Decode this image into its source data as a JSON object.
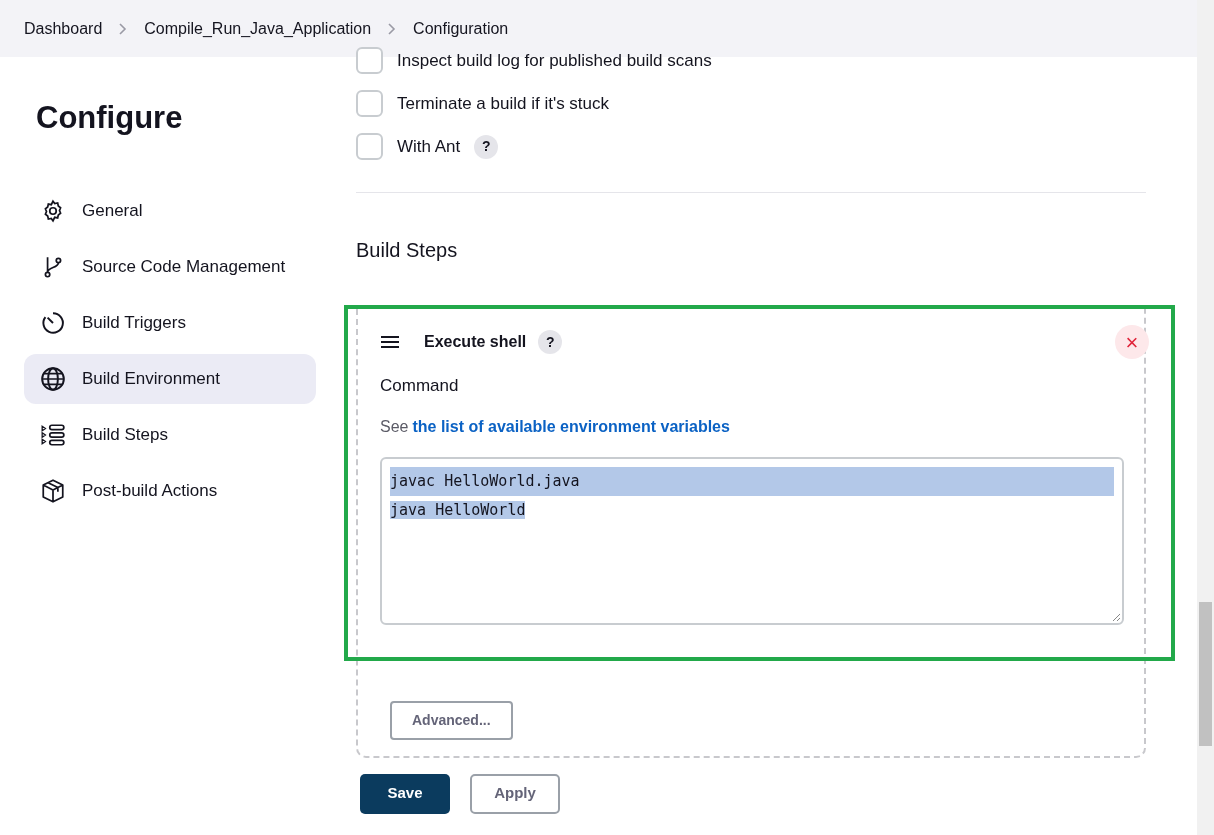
{
  "breadcrumb": [
    "Dashboard",
    "Compile_Run_Java_Application",
    "Configuration"
  ],
  "sidebar": {
    "title": "Configure",
    "items": [
      {
        "label": "General",
        "selected": false
      },
      {
        "label": "Source Code Management",
        "selected": false
      },
      {
        "label": "Build Triggers",
        "selected": false
      },
      {
        "label": "Build Environment",
        "selected": true
      },
      {
        "label": "Build Steps",
        "selected": false
      },
      {
        "label": "Post-build Actions",
        "selected": false
      }
    ]
  },
  "options": [
    {
      "label": "Inspect build log for published build scans",
      "checked": false
    },
    {
      "label": "Terminate a build if it's stuck",
      "checked": false
    },
    {
      "label": "With Ant",
      "checked": false,
      "help": "?"
    }
  ],
  "section_title": "Build Steps",
  "step": {
    "title": "Execute shell",
    "help": "?",
    "close": "×",
    "command_label": "Command",
    "hint_prefix": "See",
    "hint_link": "the list of available environment variables",
    "command_lines": [
      "javac HelloWorld.java",
      "java HelloWorld"
    ],
    "text_selected": true,
    "advanced": "Advanced..."
  },
  "buttons": [
    "Save",
    "Apply"
  ]
}
